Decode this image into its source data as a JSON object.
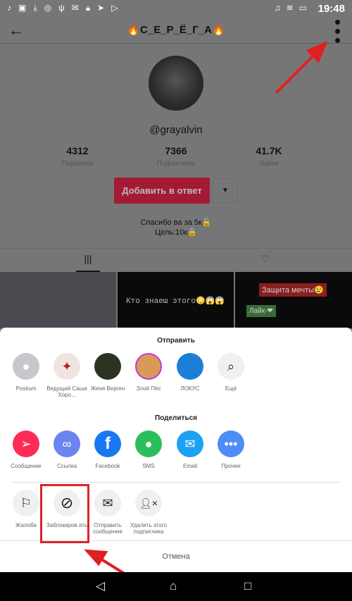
{
  "status_bar": {
    "time": "19:48",
    "left_icons": [
      "tiktok-icon",
      "image-icon",
      "download-icon",
      "instagram-icon",
      "usb-icon",
      "mail-icon",
      "lock-icon",
      "telegram-icon",
      "play-icon"
    ],
    "right_icons": [
      "headset-icon",
      "mute-icon",
      "wifi-icon",
      "battery-icon"
    ]
  },
  "header": {
    "title": "🔥С_Е_Р_Ё_Г_А🔥"
  },
  "profile": {
    "username": "@grayalvin",
    "stats": [
      {
        "value": "4312",
        "label": "Подписки"
      },
      {
        "value": "7366",
        "label": "Подписчики"
      },
      {
        "value": "41.7K",
        "label": "Лайки"
      }
    ],
    "add_button": "Добавить в ответ",
    "bio_line1": "Спасибо ва за 5к🔓",
    "bio_line2": "Цель:10к🔒"
  },
  "thumbnails": {
    "t2": "Кто знаеш этого😳😱😱",
    "t3a": "Защита мечты😢",
    "t3b": "Лайк-❤"
  },
  "sheet": {
    "send_title": "Отправить",
    "contacts": [
      {
        "label": "Postium"
      },
      {
        "label": "Ведущий Саша Хоро..."
      },
      {
        "label": "Женя Верген"
      },
      {
        "label": "Злой Пёс"
      },
      {
        "label": "ЛОКУС"
      },
      {
        "label": "Ещё"
      }
    ],
    "share_title": "Поделиться",
    "share": [
      {
        "label": "Сообщение",
        "color": "#fe2c55"
      },
      {
        "label": "Ссылка",
        "color": "#6a84f0"
      },
      {
        "label": "Facebook",
        "color": "#1877f2"
      },
      {
        "label": "SMS",
        "color": "#2bbf5c"
      },
      {
        "label": "Email",
        "color": "#1da1f2"
      },
      {
        "label": "Прочее",
        "color": "#4e8df5"
      }
    ],
    "actions": [
      {
        "label": "Жалоба"
      },
      {
        "label": "Заблокиров ать"
      },
      {
        "label": "Отправить сообщение"
      },
      {
        "label": "Удалить этого подписчика"
      }
    ],
    "cancel": "Отмена"
  },
  "annotation_color": "#e02020"
}
